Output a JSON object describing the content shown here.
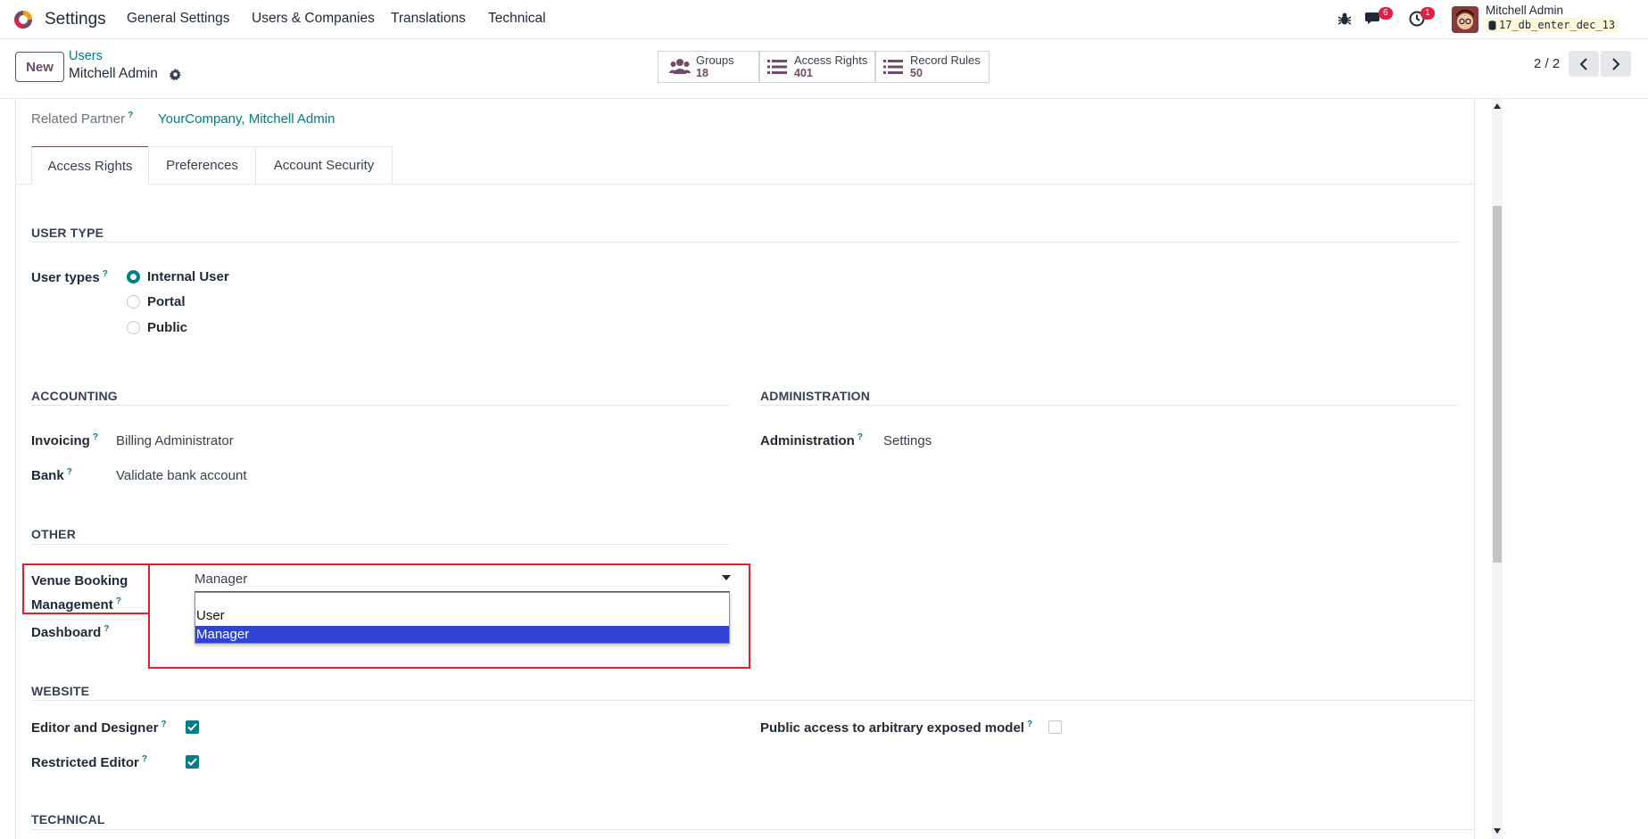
{
  "navbar": {
    "app_name": "Settings",
    "menu": [
      "General Settings",
      "Users & Companies",
      "Translations",
      "Technical"
    ],
    "messages_count": "6",
    "activities_count": "1",
    "user_name": "Mitchell Admin",
    "db_name": "17_db_enter_dec_13"
  },
  "control": {
    "new_label": "New",
    "breadcrumb_parent": "Users",
    "record_name": "Mitchell Admin",
    "stats": [
      {
        "label": "Groups",
        "value": "18"
      },
      {
        "label": "Access Rights",
        "value": "401"
      },
      {
        "label": "Record Rules",
        "value": "50"
      }
    ],
    "pager": "2 / 2"
  },
  "form": {
    "related_partner_label": "Related Partner",
    "related_partner_value": "YourCompany, Mitchell Admin",
    "tabs": [
      "Access Rights",
      "Preferences",
      "Account Security"
    ],
    "user_type_title": "USER TYPE",
    "user_types_label": "User types",
    "user_type_options": [
      "Internal User",
      "Portal",
      "Public"
    ],
    "accounting_title": "ACCOUNTING",
    "invoicing_label": "Invoicing",
    "invoicing_value": "Billing Administrator",
    "bank_label": "Bank",
    "bank_value": "Validate bank account",
    "administration_title": "ADMINISTRATION",
    "administration_label": "Administration",
    "administration_value": "Settings",
    "other_title": "OTHER",
    "venue_label_line1": "Venue Booking",
    "venue_label_line2": "Management",
    "venue_value": "Manager",
    "venue_options": [
      "User",
      "Manager"
    ],
    "dashboard_label": "Dashboard",
    "website_title": "WEBSITE",
    "editor_label": "Editor and Designer",
    "restricted_label": "Restricted Editor",
    "public_access_label": "Public access to arbitrary exposed model",
    "technical_title": "TECHNICAL",
    "help_mark": "?"
  },
  "colors": {
    "brand": "#714b67",
    "teal": "#017e84",
    "highlight": "#e11d2e",
    "selected_option": "#2f44d6"
  }
}
